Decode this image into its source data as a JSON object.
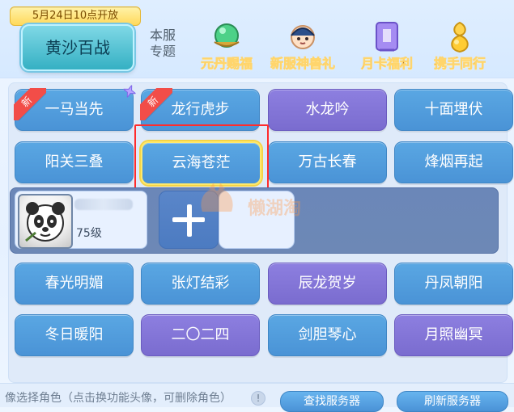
{
  "top": {
    "open_date": "5月24日10点开放",
    "hero_button": "黄沙百战",
    "server_topic": "本服\n专题",
    "promos": [
      {
        "label": "元丹赐福",
        "icon": "green-orb-icon"
      },
      {
        "label": "新服神兽礼",
        "icon": "beast-girl-icon"
      },
      {
        "label": "月卡福利",
        "icon": "month-card-icon"
      },
      {
        "label": "携手同行",
        "icon": "golden-gourd-icon"
      }
    ]
  },
  "servers": [
    {
      "label": "一马当先",
      "style": "blue",
      "badge": "新",
      "sparkle": true
    },
    {
      "label": "龙行虎步",
      "style": "blue",
      "badge": "新"
    },
    {
      "label": "水龙吟",
      "style": "purple"
    },
    {
      "label": "十面埋伏",
      "style": "blue"
    },
    {
      "label": "阳关三叠",
      "style": "blue"
    },
    {
      "label": "云海苍茫",
      "style": "blue",
      "selected": true
    },
    {
      "label": "万古长春",
      "style": "blue"
    },
    {
      "label": "烽烟再起",
      "style": "blue"
    },
    {
      "label": "春光明媚",
      "style": "blue"
    },
    {
      "label": "张灯结彩",
      "style": "blue"
    },
    {
      "label": "辰龙贺岁",
      "style": "purple"
    },
    {
      "label": "丹凤朝阳",
      "style": "blue"
    },
    {
      "label": "冬日暖阳",
      "style": "blue"
    },
    {
      "label": "二〇二四",
      "style": "purple"
    },
    {
      "label": "剑胆琴心",
      "style": "blue"
    },
    {
      "label": "月照幽冥",
      "style": "purple"
    }
  ],
  "character": {
    "level": "75级",
    "avatar_icon": "panda-avatar-icon"
  },
  "watermark": {
    "text": "懒湖淘"
  },
  "bottom": {
    "tip_text": "像选择角色（点击换功能头像，可删除角色）",
    "info_icon": "!",
    "find_server": "查找服务器",
    "refresh_server": "刷新服务器"
  },
  "colors": {
    "blue_button": "#4a93d6",
    "purple_button": "#7a6ccf",
    "selected_border": "#ffe96b",
    "highlight_red": "#ff2c2c"
  }
}
